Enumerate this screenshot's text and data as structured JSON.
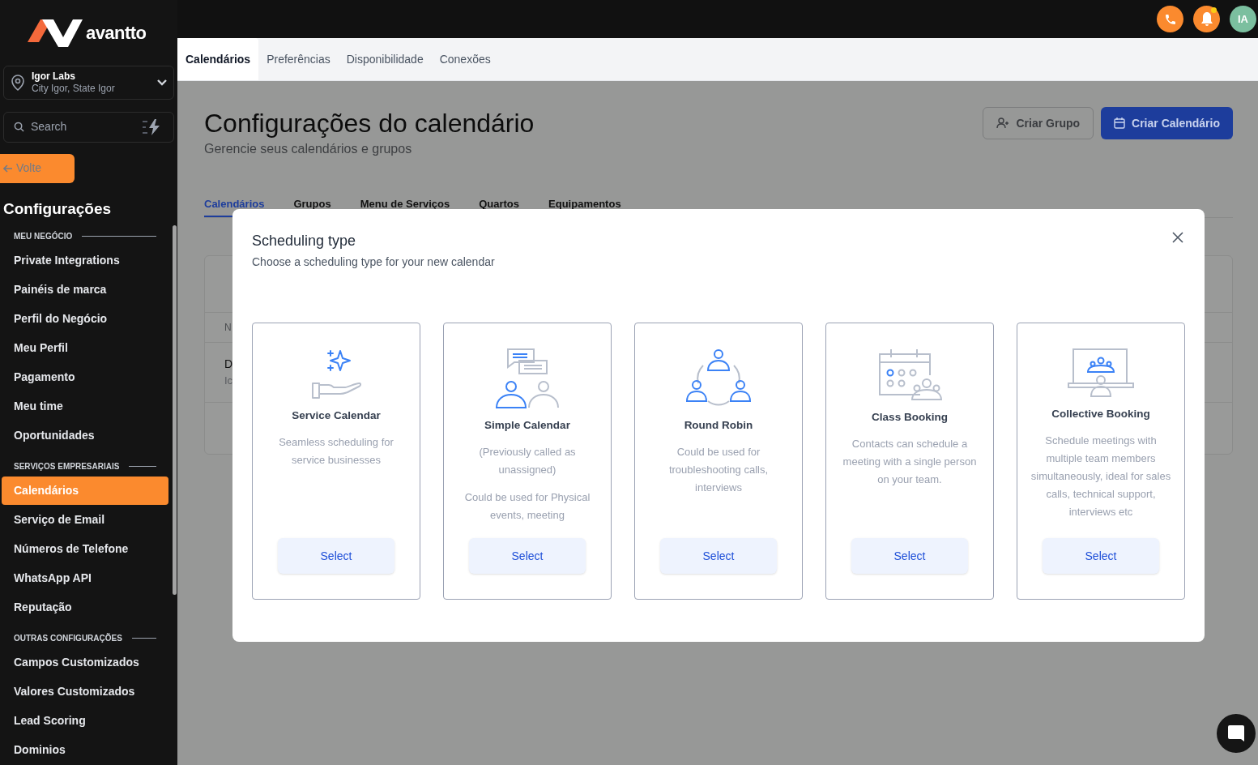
{
  "brand": {
    "name": "avantto"
  },
  "location": {
    "name": "Igor Labs",
    "address": "City Igor, State Igor"
  },
  "search": {
    "placeholder": "Search"
  },
  "back_button": {
    "label": "Volte"
  },
  "sidebar": {
    "title": "Configurações",
    "sections": [
      {
        "heading": "MEU NEGÓCIO",
        "items": [
          {
            "label": "Private Integrations",
            "selected": false
          },
          {
            "label": "Painéis de marca",
            "selected": false
          },
          {
            "label": "Perfil do Negócio",
            "selected": false
          },
          {
            "label": "Meu Perfil",
            "selected": false
          },
          {
            "label": "Pagamento",
            "selected": false
          },
          {
            "label": "Meu time",
            "selected": false
          },
          {
            "label": "Oportunidades",
            "selected": false
          }
        ]
      },
      {
        "heading": "SERVIÇOS EMPRESARIAIS",
        "items": [
          {
            "label": "Calendários",
            "selected": true
          },
          {
            "label": "Serviço de Email",
            "selected": false
          },
          {
            "label": "Números de Telefone",
            "selected": false
          },
          {
            "label": "WhatsApp API",
            "selected": false
          },
          {
            "label": "Reputação",
            "selected": false
          }
        ]
      },
      {
        "heading": "OUTRAS CONFIGURAÇÕES",
        "items": [
          {
            "label": "Campos Customizados",
            "selected": false
          },
          {
            "label": "Valores Customizados",
            "selected": false
          },
          {
            "label": "Lead Scoring",
            "selected": false
          },
          {
            "label": "Dominios",
            "selected": false
          }
        ]
      }
    ]
  },
  "topbar": {
    "avatar": "IA",
    "notification_dot": true
  },
  "tabs": [
    {
      "label": "Calendários",
      "selected": true
    },
    {
      "label": "Preferências",
      "selected": false
    },
    {
      "label": "Disponibilidade",
      "selected": false
    },
    {
      "label": "Conexões",
      "selected": false
    }
  ],
  "header": {
    "title": "Configurações do calendário",
    "subtitle": "Gerencie seus calendários e grupos",
    "buttons": [
      {
        "label": "Criar Grupo",
        "kind": "secondary"
      },
      {
        "label": "Criar Calendário",
        "kind": "primary"
      }
    ]
  },
  "subtabs": [
    {
      "label": "Calendários",
      "selected": true
    },
    {
      "label": "Grupos",
      "selected": false
    },
    {
      "label": "Menu de Serviços",
      "selected": false
    },
    {
      "label": "Quartos",
      "selected": false
    },
    {
      "label": "Equipamentos",
      "selected": false
    }
  ],
  "background_table": {
    "column_1": "N",
    "row": {
      "name": "D",
      "detail": "Ic"
    }
  },
  "modal": {
    "title": "Scheduling type",
    "subtitle": "Choose a scheduling type for your new calendar",
    "options": [
      {
        "kind": "service",
        "title": "Service Calendar",
        "descriptions": [
          "Seamless scheduling for service businesses"
        ],
        "button": "Select"
      },
      {
        "kind": "simple",
        "title": "Simple Calendar",
        "descriptions": [
          "(Previously called as unassigned)",
          "Could be used for Physical events, meeting"
        ],
        "button": "Select"
      },
      {
        "kind": "round_robin",
        "title": "Round Robin",
        "descriptions": [
          "Could be used for troubleshooting calls, interviews"
        ],
        "button": "Select"
      },
      {
        "kind": "class",
        "title": "Class Booking",
        "descriptions": [
          "Contacts can schedule a meeting with a single person on your team."
        ],
        "button": "Select"
      },
      {
        "kind": "collective",
        "title": "Collective Booking",
        "descriptions": [
          "Schedule meetings with multiple team members simultaneously, ideal for sales calls, technical support, interviews etc"
        ],
        "button": "Select"
      }
    ]
  }
}
